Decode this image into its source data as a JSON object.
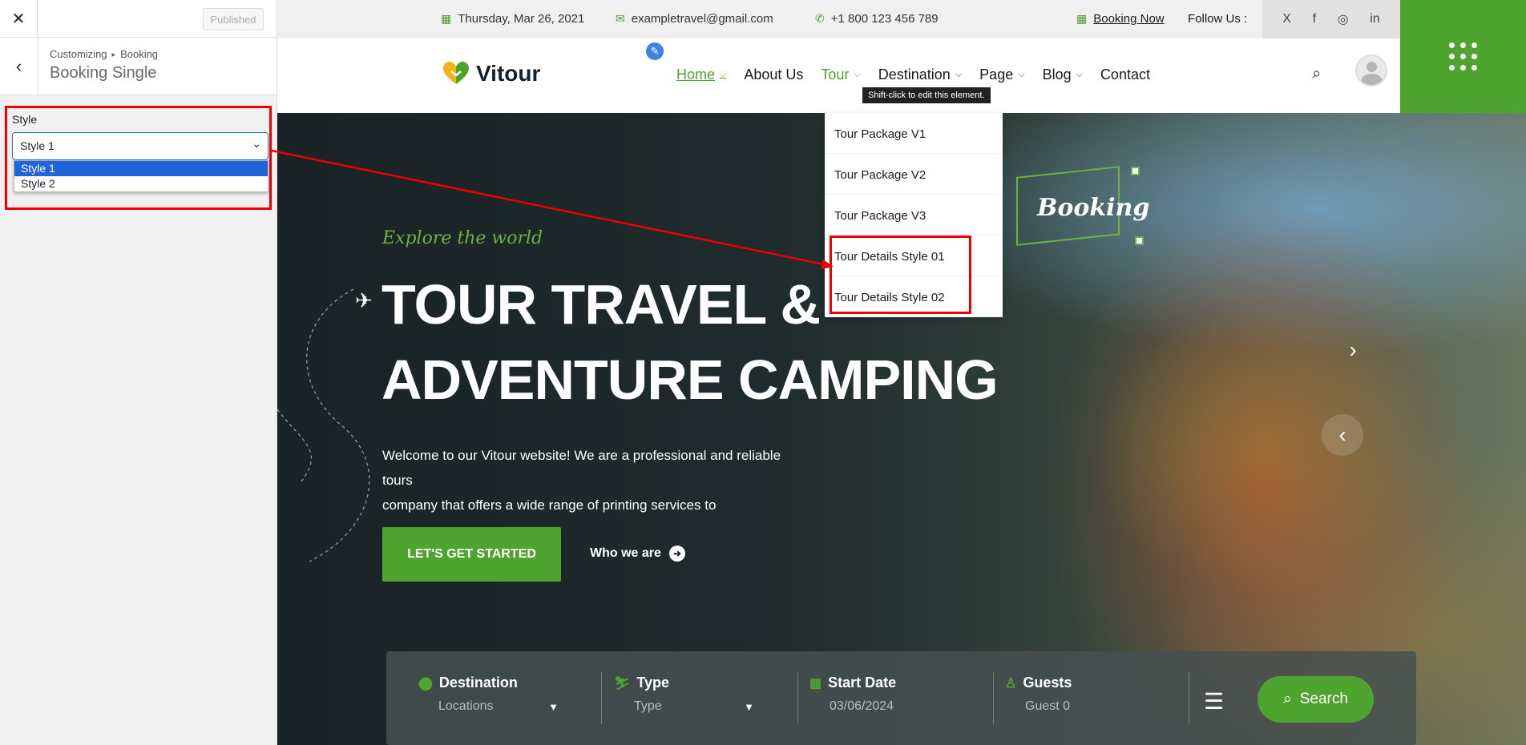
{
  "customizer": {
    "close_icon": "close-icon",
    "publish_label": "Published",
    "back_icon": "back-chevron-icon",
    "breadcrumb_parent": "Customizing",
    "breadcrumb_sep": "▸",
    "breadcrumb_child": "Booking",
    "section_title": "Booking Single",
    "style_label": "Style",
    "style_value": "Style 1",
    "style_options": [
      "Style 1",
      "Style 2"
    ]
  },
  "topbar": {
    "date": "Thursday, Mar 26, 2021",
    "email": "exampletravel@gmail.com",
    "phone": "+1 800 123 456 789",
    "booking": "Booking Now",
    "follow": "Follow Us :",
    "socials": [
      "X",
      "f",
      "◎",
      "in"
    ]
  },
  "header": {
    "logo": "Vitour",
    "nav": [
      {
        "label": "Home"
      },
      {
        "label": "About Us"
      },
      {
        "label": "Tour"
      },
      {
        "label": "Destination"
      },
      {
        "label": "Page"
      },
      {
        "label": "Blog"
      },
      {
        "label": "Contact"
      }
    ],
    "tooltip": "Shift-click to edit this element."
  },
  "dropdown": {
    "items": [
      "Tour Package V1",
      "Tour Package V2",
      "Tour Package V3",
      "Tour Details Style 01",
      "Tour Details Style 02"
    ]
  },
  "hero": {
    "subtitle": "Explore the world",
    "title_line1": "TOUR TRAVEL &",
    "title_line2": "ADVENTURE CAMPING",
    "desc_line1": "Welcome to our Vitour website! We are a professional and reliable tours",
    "desc_line2": "company that offers a wide range of printing services to",
    "cta_start": "LET'S GET STARTED",
    "cta_who": "Who we are",
    "script_text": "Booking"
  },
  "search": {
    "destination_label": "Destination",
    "destination_value": "Locations",
    "type_label": "Type",
    "type_value": "Type",
    "date_label": "Start Date",
    "date_value": "03/06/2024",
    "guests_label": "Guests",
    "guests_value": "Guest 0",
    "button": "Search"
  },
  "colors": {
    "brand_green": "#4ea42e",
    "annotation_red": "#e00000",
    "select_blue": "#1f64d8"
  }
}
